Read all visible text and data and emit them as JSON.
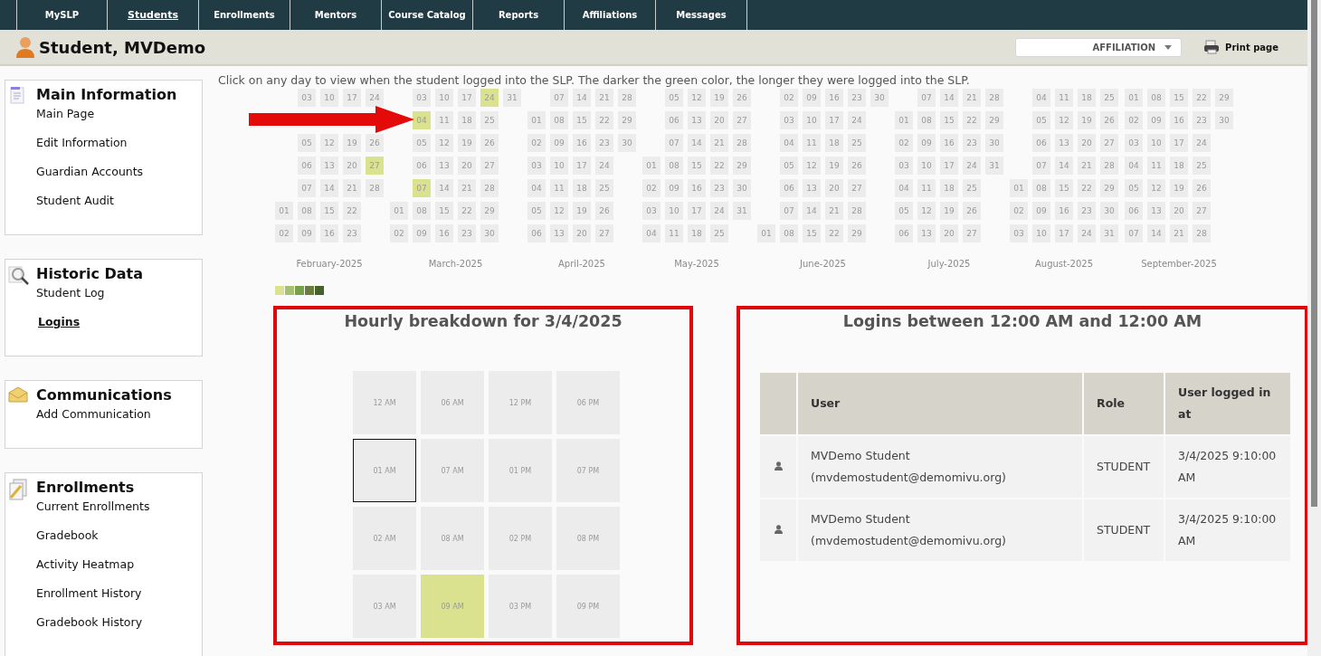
{
  "nav_tabs": [
    {
      "label": "MySLP",
      "selected": false
    },
    {
      "label": "Students",
      "selected": true
    },
    {
      "label": "Enrollments",
      "selected": false
    },
    {
      "label": "Mentors",
      "selected": false
    },
    {
      "label": "Course Catalog",
      "selected": false
    },
    {
      "label": "Reports",
      "selected": false
    },
    {
      "label": "Affiliations",
      "selected": false
    },
    {
      "label": "Messages",
      "selected": false
    }
  ],
  "header": {
    "title": "Student, MVDemo",
    "affiliation": "AFFILIATION",
    "print": "Print page"
  },
  "sidebar": [
    {
      "title": "Main Information",
      "items": [
        {
          "label": "Main Page",
          "selected": false
        },
        {
          "label": "Edit Information",
          "selected": false
        },
        {
          "label": "Guardian Accounts",
          "selected": false
        },
        {
          "label": "Student Audit",
          "selected": false
        }
      ]
    },
    {
      "title": "Historic Data",
      "items": [
        {
          "label": "Student Log",
          "selected": false
        },
        {
          "label": "Logins",
          "selected": true
        }
      ]
    },
    {
      "title": "Communications",
      "items": [
        {
          "label": "Add Communication",
          "selected": false
        }
      ]
    },
    {
      "title": "Enrollments",
      "items": [
        {
          "label": "Current Enrollments",
          "selected": false
        },
        {
          "label": "Gradebook",
          "selected": false
        },
        {
          "label": "Activity Heatmap",
          "selected": false
        },
        {
          "label": "Enrollment History",
          "selected": false
        },
        {
          "label": "Gradebook History",
          "selected": false
        }
      ]
    }
  ],
  "intro": "Click on any day to view when the student logged into the SLP. The darker the green color, the longer they were logged into the SLP.",
  "months": [
    {
      "label": "February-2025",
      "weeks": [
        [
          {
            "kind": "day",
            "day": "01",
            "logged_in": false
          },
          {
            "kind": "day",
            "day": "02",
            "logged_in": false
          }
        ],
        [
          {
            "kind": "day",
            "day": "03",
            "logged_in": false
          },
          {
            "kind": "covered"
          },
          {
            "kind": "day",
            "day": "05",
            "logged_in": false
          },
          {
            "kind": "day",
            "day": "06",
            "logged_in": false
          },
          {
            "kind": "day",
            "day": "07",
            "logged_in": false
          },
          {
            "kind": "day",
            "day": "08",
            "logged_in": false
          },
          {
            "kind": "day",
            "day": "09",
            "logged_in": false
          }
        ],
        [
          {
            "kind": "day",
            "day": "10",
            "logged_in": false
          },
          {
            "kind": "covered"
          },
          {
            "kind": "day",
            "day": "12",
            "logged_in": false
          },
          {
            "kind": "day",
            "day": "13",
            "logged_in": false
          },
          {
            "kind": "day",
            "day": "14",
            "logged_in": false
          },
          {
            "kind": "day",
            "day": "15",
            "logged_in": false
          },
          {
            "kind": "day",
            "day": "16",
            "logged_in": false
          }
        ],
        [
          {
            "kind": "day",
            "day": "17",
            "logged_in": false
          },
          {
            "kind": "covered"
          },
          {
            "kind": "day",
            "day": "19",
            "logged_in": false
          },
          {
            "kind": "day",
            "day": "20",
            "logged_in": false
          },
          {
            "kind": "day",
            "day": "21",
            "logged_in": false
          },
          {
            "kind": "day",
            "day": "22",
            "logged_in": false
          },
          {
            "kind": "day",
            "day": "23",
            "logged_in": false
          }
        ],
        [
          {
            "kind": "day",
            "day": "24",
            "logged_in": false
          },
          {
            "kind": "covered"
          },
          {
            "kind": "day",
            "day": "26",
            "logged_in": false
          },
          {
            "kind": "day",
            "day": "27",
            "logged_in": true
          },
          {
            "kind": "day",
            "day": "28",
            "logged_in": false
          }
        ]
      ]
    },
    {
      "label": "March-2025",
      "weeks": [
        [
          {
            "kind": "day",
            "day": "01",
            "logged_in": false
          },
          {
            "kind": "day",
            "day": "02",
            "logged_in": false
          }
        ],
        [
          {
            "kind": "day",
            "day": "03",
            "logged_in": false
          },
          {
            "kind": "day",
            "day": "04",
            "logged_in": true
          },
          {
            "kind": "day",
            "day": "05",
            "logged_in": false
          },
          {
            "kind": "day",
            "day": "06",
            "logged_in": false
          },
          {
            "kind": "day",
            "day": "07",
            "logged_in": true
          },
          {
            "kind": "day",
            "day": "08",
            "logged_in": false
          },
          {
            "kind": "day",
            "day": "09",
            "logged_in": false
          }
        ],
        [
          {
            "kind": "day",
            "day": "10",
            "logged_in": false
          },
          {
            "kind": "day",
            "day": "11",
            "logged_in": false
          },
          {
            "kind": "day",
            "day": "12",
            "logged_in": false
          },
          {
            "kind": "day",
            "day": "13",
            "logged_in": false
          },
          {
            "kind": "day",
            "day": "14",
            "logged_in": false
          },
          {
            "kind": "day",
            "day": "15",
            "logged_in": false
          },
          {
            "kind": "day",
            "day": "16",
            "logged_in": false
          }
        ],
        [
          {
            "kind": "day",
            "day": "17",
            "logged_in": false
          },
          {
            "kind": "day",
            "day": "18",
            "logged_in": false
          },
          {
            "kind": "day",
            "day": "19",
            "logged_in": false
          },
          {
            "kind": "day",
            "day": "20",
            "logged_in": false
          },
          {
            "kind": "day",
            "day": "21",
            "logged_in": false
          },
          {
            "kind": "day",
            "day": "22",
            "logged_in": false
          },
          {
            "kind": "day",
            "day": "23",
            "logged_in": false
          }
        ],
        [
          {
            "kind": "day",
            "day": "24",
            "logged_in": true
          },
          {
            "kind": "day",
            "day": "25",
            "logged_in": false
          },
          {
            "kind": "day",
            "day": "26",
            "logged_in": false
          },
          {
            "kind": "day",
            "day": "27",
            "logged_in": false
          },
          {
            "kind": "day",
            "day": "28",
            "logged_in": false
          },
          {
            "kind": "day",
            "day": "29",
            "logged_in": false
          },
          {
            "kind": "day",
            "day": "30",
            "logged_in": false
          }
        ],
        [
          {
            "kind": "day",
            "day": "31",
            "logged_in": false
          }
        ]
      ]
    },
    {
      "label": "April-2025",
      "weeks": [
        [
          {
            "kind": "day",
            "day": "01",
            "logged_in": false
          },
          {
            "kind": "day",
            "day": "02",
            "logged_in": false
          },
          {
            "kind": "day",
            "day": "03",
            "logged_in": false
          },
          {
            "kind": "day",
            "day": "04",
            "logged_in": false
          },
          {
            "kind": "day",
            "day": "05",
            "logged_in": false
          },
          {
            "kind": "day",
            "day": "06",
            "logged_in": false
          }
        ],
        [
          {
            "kind": "day",
            "day": "07",
            "logged_in": false
          },
          {
            "kind": "day",
            "day": "08",
            "logged_in": false
          },
          {
            "kind": "day",
            "day": "09",
            "logged_in": false
          },
          {
            "kind": "day",
            "day": "10",
            "logged_in": false
          },
          {
            "kind": "day",
            "day": "11",
            "logged_in": false
          },
          {
            "kind": "day",
            "day": "12",
            "logged_in": false
          },
          {
            "kind": "day",
            "day": "13",
            "logged_in": false
          }
        ],
        [
          {
            "kind": "day",
            "day": "14",
            "logged_in": false
          },
          {
            "kind": "day",
            "day": "15",
            "logged_in": false
          },
          {
            "kind": "day",
            "day": "16",
            "logged_in": false
          },
          {
            "kind": "day",
            "day": "17",
            "logged_in": false
          },
          {
            "kind": "day",
            "day": "18",
            "logged_in": false
          },
          {
            "kind": "day",
            "day": "19",
            "logged_in": false
          },
          {
            "kind": "day",
            "day": "20",
            "logged_in": false
          }
        ],
        [
          {
            "kind": "day",
            "day": "21",
            "logged_in": false
          },
          {
            "kind": "day",
            "day": "22",
            "logged_in": false
          },
          {
            "kind": "day",
            "day": "23",
            "logged_in": false
          },
          {
            "kind": "day",
            "day": "24",
            "logged_in": false
          },
          {
            "kind": "day",
            "day": "25",
            "logged_in": false
          },
          {
            "kind": "day",
            "day": "26",
            "logged_in": false
          },
          {
            "kind": "day",
            "day": "27",
            "logged_in": false
          }
        ],
        [
          {
            "kind": "day",
            "day": "28",
            "logged_in": false
          },
          {
            "kind": "day",
            "day": "29",
            "logged_in": false
          },
          {
            "kind": "day",
            "day": "30",
            "logged_in": false
          }
        ]
      ]
    },
    {
      "label": "May-2025",
      "weeks": [
        [
          {
            "kind": "day",
            "day": "01",
            "logged_in": false
          },
          {
            "kind": "day",
            "day": "02",
            "logged_in": false
          },
          {
            "kind": "day",
            "day": "03",
            "logged_in": false
          },
          {
            "kind": "day",
            "day": "04",
            "logged_in": false
          }
        ],
        [
          {
            "kind": "day",
            "day": "05",
            "logged_in": false
          },
          {
            "kind": "day",
            "day": "06",
            "logged_in": false
          },
          {
            "kind": "day",
            "day": "07",
            "logged_in": false
          },
          {
            "kind": "day",
            "day": "08",
            "logged_in": false
          },
          {
            "kind": "day",
            "day": "09",
            "logged_in": false
          },
          {
            "kind": "day",
            "day": "10",
            "logged_in": false
          },
          {
            "kind": "day",
            "day": "11",
            "logged_in": false
          }
        ],
        [
          {
            "kind": "day",
            "day": "12",
            "logged_in": false
          },
          {
            "kind": "day",
            "day": "13",
            "logged_in": false
          },
          {
            "kind": "day",
            "day": "14",
            "logged_in": false
          },
          {
            "kind": "day",
            "day": "15",
            "logged_in": false
          },
          {
            "kind": "day",
            "day": "16",
            "logged_in": false
          },
          {
            "kind": "day",
            "day": "17",
            "logged_in": false
          },
          {
            "kind": "day",
            "day": "18",
            "logged_in": false
          }
        ],
        [
          {
            "kind": "day",
            "day": "19",
            "logged_in": false
          },
          {
            "kind": "day",
            "day": "20",
            "logged_in": false
          },
          {
            "kind": "day",
            "day": "21",
            "logged_in": false
          },
          {
            "kind": "day",
            "day": "22",
            "logged_in": false
          },
          {
            "kind": "day",
            "day": "23",
            "logged_in": false
          },
          {
            "kind": "day",
            "day": "24",
            "logged_in": false
          },
          {
            "kind": "day",
            "day": "25",
            "logged_in": false
          }
        ],
        [
          {
            "kind": "day",
            "day": "26",
            "logged_in": false
          },
          {
            "kind": "day",
            "day": "27",
            "logged_in": false
          },
          {
            "kind": "day",
            "day": "28",
            "logged_in": false
          },
          {
            "kind": "day",
            "day": "29",
            "logged_in": false
          },
          {
            "kind": "day",
            "day": "30",
            "logged_in": false
          },
          {
            "kind": "day",
            "day": "31",
            "logged_in": false
          }
        ]
      ]
    },
    {
      "label": "June-2025",
      "weeks": [
        [
          {
            "kind": "day",
            "day": "01",
            "logged_in": false
          }
        ],
        [
          {
            "kind": "day",
            "day": "02",
            "logged_in": false
          },
          {
            "kind": "day",
            "day": "03",
            "logged_in": false
          },
          {
            "kind": "day",
            "day": "04",
            "logged_in": false
          },
          {
            "kind": "day",
            "day": "05",
            "logged_in": false
          },
          {
            "kind": "day",
            "day": "06",
            "logged_in": false
          },
          {
            "kind": "day",
            "day": "07",
            "logged_in": false
          },
          {
            "kind": "day",
            "day": "08",
            "logged_in": false
          }
        ],
        [
          {
            "kind": "day",
            "day": "09",
            "logged_in": false
          },
          {
            "kind": "day",
            "day": "10",
            "logged_in": false
          },
          {
            "kind": "day",
            "day": "11",
            "logged_in": false
          },
          {
            "kind": "day",
            "day": "12",
            "logged_in": false
          },
          {
            "kind": "day",
            "day": "13",
            "logged_in": false
          },
          {
            "kind": "day",
            "day": "14",
            "logged_in": false
          },
          {
            "kind": "day",
            "day": "15",
            "logged_in": false
          }
        ],
        [
          {
            "kind": "day",
            "day": "16",
            "logged_in": false
          },
          {
            "kind": "day",
            "day": "17",
            "logged_in": false
          },
          {
            "kind": "day",
            "day": "18",
            "logged_in": false
          },
          {
            "kind": "day",
            "day": "19",
            "logged_in": false
          },
          {
            "kind": "day",
            "day": "20",
            "logged_in": false
          },
          {
            "kind": "day",
            "day": "21",
            "logged_in": false
          },
          {
            "kind": "day",
            "day": "22",
            "logged_in": false
          }
        ],
        [
          {
            "kind": "day",
            "day": "23",
            "logged_in": false
          },
          {
            "kind": "day",
            "day": "24",
            "logged_in": false
          },
          {
            "kind": "day",
            "day": "25",
            "logged_in": false
          },
          {
            "kind": "day",
            "day": "26",
            "logged_in": false
          },
          {
            "kind": "day",
            "day": "27",
            "logged_in": false
          },
          {
            "kind": "day",
            "day": "28",
            "logged_in": false
          },
          {
            "kind": "day",
            "day": "29",
            "logged_in": false
          }
        ],
        [
          {
            "kind": "day",
            "day": "30",
            "logged_in": false
          }
        ]
      ]
    },
    {
      "label": "July-2025",
      "weeks": [
        [
          {
            "kind": "day",
            "day": "01",
            "logged_in": false
          },
          {
            "kind": "day",
            "day": "02",
            "logged_in": false
          },
          {
            "kind": "day",
            "day": "03",
            "logged_in": false
          },
          {
            "kind": "day",
            "day": "04",
            "logged_in": false
          },
          {
            "kind": "day",
            "day": "05",
            "logged_in": false
          },
          {
            "kind": "day",
            "day": "06",
            "logged_in": false
          }
        ],
        [
          {
            "kind": "day",
            "day": "07",
            "logged_in": false
          },
          {
            "kind": "day",
            "day": "08",
            "logged_in": false
          },
          {
            "kind": "day",
            "day": "09",
            "logged_in": false
          },
          {
            "kind": "day",
            "day": "10",
            "logged_in": false
          },
          {
            "kind": "day",
            "day": "11",
            "logged_in": false
          },
          {
            "kind": "day",
            "day": "12",
            "logged_in": false
          },
          {
            "kind": "day",
            "day": "13",
            "logged_in": false
          }
        ],
        [
          {
            "kind": "day",
            "day": "14",
            "logged_in": false
          },
          {
            "kind": "day",
            "day": "15",
            "logged_in": false
          },
          {
            "kind": "day",
            "day": "16",
            "logged_in": false
          },
          {
            "kind": "day",
            "day": "17",
            "logged_in": false
          },
          {
            "kind": "day",
            "day": "18",
            "logged_in": false
          },
          {
            "kind": "day",
            "day": "19",
            "logged_in": false
          },
          {
            "kind": "day",
            "day": "20",
            "logged_in": false
          }
        ],
        [
          {
            "kind": "day",
            "day": "21",
            "logged_in": false
          },
          {
            "kind": "day",
            "day": "22",
            "logged_in": false
          },
          {
            "kind": "day",
            "day": "23",
            "logged_in": false
          },
          {
            "kind": "day",
            "day": "24",
            "logged_in": false
          },
          {
            "kind": "day",
            "day": "25",
            "logged_in": false
          },
          {
            "kind": "day",
            "day": "26",
            "logged_in": false
          },
          {
            "kind": "day",
            "day": "27",
            "logged_in": false
          }
        ],
        [
          {
            "kind": "day",
            "day": "28",
            "logged_in": false
          },
          {
            "kind": "day",
            "day": "29",
            "logged_in": false
          },
          {
            "kind": "day",
            "day": "30",
            "logged_in": false
          },
          {
            "kind": "day",
            "day": "31",
            "logged_in": false
          }
        ]
      ]
    },
    {
      "label": "August-2025",
      "weeks": [
        [
          {
            "kind": "day",
            "day": "01",
            "logged_in": false
          },
          {
            "kind": "day",
            "day": "02",
            "logged_in": false
          },
          {
            "kind": "day",
            "day": "03",
            "logged_in": false
          }
        ],
        [
          {
            "kind": "day",
            "day": "04",
            "logged_in": false
          },
          {
            "kind": "day",
            "day": "05",
            "logged_in": false
          },
          {
            "kind": "day",
            "day": "06",
            "logged_in": false
          },
          {
            "kind": "day",
            "day": "07",
            "logged_in": false
          },
          {
            "kind": "day",
            "day": "08",
            "logged_in": false
          },
          {
            "kind": "day",
            "day": "09",
            "logged_in": false
          },
          {
            "kind": "day",
            "day": "10",
            "logged_in": false
          }
        ],
        [
          {
            "kind": "day",
            "day": "11",
            "logged_in": false
          },
          {
            "kind": "day",
            "day": "12",
            "logged_in": false
          },
          {
            "kind": "day",
            "day": "13",
            "logged_in": false
          },
          {
            "kind": "day",
            "day": "14",
            "logged_in": false
          },
          {
            "kind": "day",
            "day": "15",
            "logged_in": false
          },
          {
            "kind": "day",
            "day": "16",
            "logged_in": false
          },
          {
            "kind": "day",
            "day": "17",
            "logged_in": false
          }
        ],
        [
          {
            "kind": "day",
            "day": "18",
            "logged_in": false
          },
          {
            "kind": "day",
            "day": "19",
            "logged_in": false
          },
          {
            "kind": "day",
            "day": "20",
            "logged_in": false
          },
          {
            "kind": "day",
            "day": "21",
            "logged_in": false
          },
          {
            "kind": "day",
            "day": "22",
            "logged_in": false
          },
          {
            "kind": "day",
            "day": "23",
            "logged_in": false
          },
          {
            "kind": "day",
            "day": "24",
            "logged_in": false
          }
        ],
        [
          {
            "kind": "day",
            "day": "25",
            "logged_in": false
          },
          {
            "kind": "day",
            "day": "26",
            "logged_in": false
          },
          {
            "kind": "day",
            "day": "27",
            "logged_in": false
          },
          {
            "kind": "day",
            "day": "28",
            "logged_in": false
          },
          {
            "kind": "day",
            "day": "29",
            "logged_in": false
          },
          {
            "kind": "day",
            "day": "30",
            "logged_in": false
          },
          {
            "kind": "day",
            "day": "31",
            "logged_in": false
          }
        ]
      ]
    },
    {
      "label": "September-2025",
      "weeks": [
        [
          {
            "kind": "day",
            "day": "01",
            "logged_in": false
          },
          {
            "kind": "day",
            "day": "02",
            "logged_in": false
          },
          {
            "kind": "day",
            "day": "03",
            "logged_in": false
          },
          {
            "kind": "day",
            "day": "04",
            "logged_in": false
          },
          {
            "kind": "day",
            "day": "05",
            "logged_in": false
          },
          {
            "kind": "day",
            "day": "06",
            "logged_in": false
          },
          {
            "kind": "day",
            "day": "07",
            "logged_in": false
          }
        ],
        [
          {
            "kind": "day",
            "day": "08",
            "logged_in": false
          },
          {
            "kind": "day",
            "day": "09",
            "logged_in": false
          },
          {
            "kind": "day",
            "day": "10",
            "logged_in": false
          },
          {
            "kind": "day",
            "day": "11",
            "logged_in": false
          },
          {
            "kind": "day",
            "day": "12",
            "logged_in": false
          },
          {
            "kind": "day",
            "day": "13",
            "logged_in": false
          },
          {
            "kind": "day",
            "day": "14",
            "logged_in": false
          }
        ],
        [
          {
            "kind": "day",
            "day": "15",
            "logged_in": false
          },
          {
            "kind": "day",
            "day": "16",
            "logged_in": false
          },
          {
            "kind": "day",
            "day": "17",
            "logged_in": false
          },
          {
            "kind": "day",
            "day": "18",
            "logged_in": false
          },
          {
            "kind": "day",
            "day": "19",
            "logged_in": false
          },
          {
            "kind": "day",
            "day": "20",
            "logged_in": false
          },
          {
            "kind": "day",
            "day": "21",
            "logged_in": false
          }
        ],
        [
          {
            "kind": "day",
            "day": "22",
            "logged_in": false
          },
          {
            "kind": "day",
            "day": "23",
            "logged_in": false
          },
          {
            "kind": "day",
            "day": "24",
            "logged_in": false
          },
          {
            "kind": "day",
            "day": "25",
            "logged_in": false
          },
          {
            "kind": "day",
            "day": "26",
            "logged_in": false
          },
          {
            "kind": "day",
            "day": "27",
            "logged_in": false
          },
          {
            "kind": "day",
            "day": "28",
            "logged_in": false
          }
        ],
        [
          {
            "kind": "day",
            "day": "29",
            "logged_in": false
          },
          {
            "kind": "day",
            "day": "30",
            "logged_in": false
          }
        ]
      ]
    }
  ],
  "legend": [
    {
      "color": "#dbe28f"
    },
    {
      "color": "#a4c070"
    },
    {
      "color": "#77a04c"
    },
    {
      "color": "#6b7c3f"
    },
    {
      "color": "#44622a"
    }
  ],
  "hourly": {
    "title": "Hourly breakdown for 3/4/2025",
    "columns": [
      [
        {
          "label": "12 AM",
          "logged_in": false,
          "selected": false
        },
        {
          "label": "01 AM",
          "logged_in": false,
          "selected": true
        },
        {
          "label": "02 AM",
          "logged_in": false,
          "selected": false
        },
        {
          "label": "03 AM",
          "logged_in": false,
          "selected": false
        }
      ],
      [
        {
          "label": "06 AM",
          "logged_in": false,
          "selected": false
        },
        {
          "label": "07 AM",
          "logged_in": false,
          "selected": false
        },
        {
          "label": "08 AM",
          "logged_in": false,
          "selected": false
        },
        {
          "label": "09 AM",
          "logged_in": true,
          "selected": false
        }
      ],
      [
        {
          "label": "12 PM",
          "logged_in": false,
          "selected": false
        },
        {
          "label": "01 PM",
          "logged_in": false,
          "selected": false
        },
        {
          "label": "02 PM",
          "logged_in": false,
          "selected": false
        },
        {
          "label": "03 PM",
          "logged_in": false,
          "selected": false
        }
      ],
      [
        {
          "label": "06 PM",
          "logged_in": false,
          "selected": false
        },
        {
          "label": "07 PM",
          "logged_in": false,
          "selected": false
        },
        {
          "label": "08 PM",
          "logged_in": false,
          "selected": false
        },
        {
          "label": "09 PM",
          "logged_in": false,
          "selected": false
        }
      ]
    ]
  },
  "logins": {
    "title": "Logins between 12:00 AM and 12:00 AM",
    "columns": [
      "User",
      "Role",
      "User logged in at"
    ],
    "rows": [
      {
        "user": "MVDemo Student (mvdemostudent@demomivu.org)",
        "role": "STUDENT",
        "time": "3/4/2025 9:10:00 AM"
      },
      {
        "user": "MVDemo Student (mvdemostudent@demomivu.org)",
        "role": "STUDENT",
        "time": "3/4/2025 9:10:00 AM"
      }
    ]
  }
}
